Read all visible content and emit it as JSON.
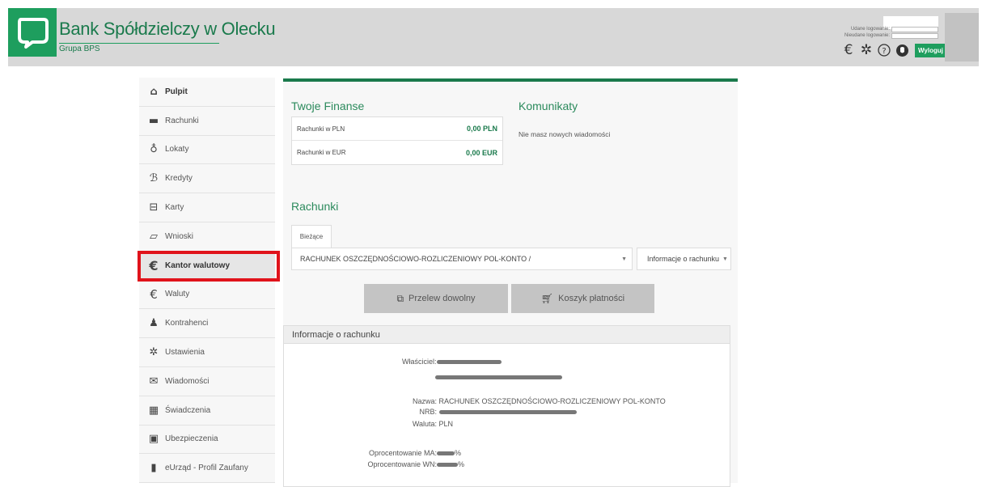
{
  "header": {
    "bank_name": "Bank Spółdzielczy w Olecku",
    "bank_group": "Grupa BPS",
    "login_success_label": "Udane logowanie:",
    "login_failed_label": "Nieudane logowanie:",
    "logout_label": "Wyloguj",
    "icons": [
      "euro-icon",
      "gear-icon",
      "help-icon",
      "accessibility-icon"
    ],
    "brand_color": "#1e9e5e"
  },
  "sidebar": {
    "items": [
      {
        "label": "Pulpit",
        "icon": "home-icon",
        "glyph": "⌂"
      },
      {
        "label": "Rachunki",
        "icon": "wallet-icon",
        "glyph": "▬"
      },
      {
        "label": "Lokaty",
        "icon": "coins-icon",
        "glyph": "♁"
      },
      {
        "label": "Kredyty",
        "icon": "coins-hand-icon",
        "glyph": "ℬ"
      },
      {
        "label": "Karty",
        "icon": "card-icon",
        "glyph": "⊟"
      },
      {
        "label": "Wnioski",
        "icon": "document-icon",
        "glyph": "▱"
      },
      {
        "label": "Kantor walutowy",
        "icon": "euro-icon",
        "glyph": "€"
      },
      {
        "label": "Waluty",
        "icon": "euro-icon",
        "glyph": "€"
      },
      {
        "label": "Kontrahenci",
        "icon": "user-icon",
        "glyph": "♟"
      },
      {
        "label": "Ustawienia",
        "icon": "gear-icon",
        "glyph": "✲"
      },
      {
        "label": "Wiadomości",
        "icon": "envelope-icon",
        "glyph": "✉"
      },
      {
        "label": "Świadczenia",
        "icon": "calculator-icon",
        "glyph": "▦"
      },
      {
        "label": "Ubezpieczenia",
        "icon": "insurance-icon",
        "glyph": "▣"
      },
      {
        "label": "eUrząd - Profil Zaufany",
        "icon": "building-icon",
        "glyph": "▮"
      }
    ],
    "highlight_color": "#e0131b"
  },
  "finances": {
    "title": "Twoje Finanse",
    "rows": [
      {
        "label": "Rachunki w PLN",
        "value": "0,00 PLN"
      },
      {
        "label": "Rachunki w EUR",
        "value": "0,00 EUR"
      }
    ]
  },
  "messages": {
    "title": "Komunikaty",
    "empty_text": "Nie masz nowych wiadomości"
  },
  "accounts": {
    "title": "Rachunki",
    "tab_label": "Bieżące",
    "selected_account": "RACHUNEK OSZCZĘDNOŚCIOWO-ROZLICZENIOWY POL-KONTO /",
    "info_dropdown": "Informacje o rachunku",
    "transfer_button": "Przelew dowolny",
    "basket_button": "Koszyk płatności"
  },
  "account_info": {
    "title": "Informacje o rachunku",
    "owner_label": "Właściciel:",
    "name_label": "Nazwa:",
    "name_value": "RACHUNEK OSZCZĘDNOŚCIOWO-ROZLICZENIOWY POL-KONTO",
    "nrb_label": "NRB:",
    "currency_label": "Waluta:",
    "currency_value": "PLN",
    "rate_ma_label": "Oprocentowanie MA:",
    "rate_wn_label": "Oprocentowanie WN:",
    "percent": "%"
  }
}
